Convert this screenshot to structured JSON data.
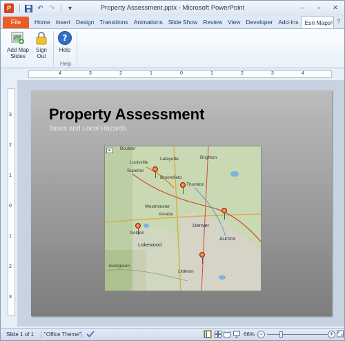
{
  "window": {
    "title": "Property Assessment.pptx - Microsoft PowerPoint",
    "app_icon": "P",
    "controls": [
      "–",
      "▫",
      "✕"
    ]
  },
  "qat": {
    "save_icon": "💾",
    "undo_icon": "↶",
    "redo_icon": "↷",
    "customize_icon": "▾"
  },
  "tabs": {
    "file_label": "File",
    "items": [
      "Home",
      "Insert",
      "Design",
      "Transitions",
      "Animations",
      "Slide Show",
      "Review",
      "View",
      "Developer",
      "Add-Ins",
      "Esri Maps"
    ],
    "active": "Esri Maps",
    "minimize_icon": "▵",
    "help_icon": "?"
  },
  "ribbon": {
    "add_map_label_1": "Add Map",
    "add_map_label_2": "Slides",
    "sign_out_label_1": "Sign",
    "sign_out_label_2": "Out",
    "help_label": "Help",
    "help_group_label": "Help"
  },
  "ruler": {
    "h_labels": [
      "4",
      "3",
      "2",
      "1",
      "0",
      "1",
      "2",
      "3",
      "4"
    ],
    "v_labels": [
      "3",
      "2",
      "1",
      "0",
      "1",
      "2",
      "3"
    ]
  },
  "slide": {
    "title": "Property Assessment",
    "subtitle": "Taxes and Local Hazards"
  },
  "map": {
    "expand_glyph": "▸",
    "labels": [
      "Boulder",
      "Lafayette",
      "Brighton",
      "Louisville",
      "Superior",
      "Broomfield",
      "Thornton",
      "Westminster",
      "Arvada",
      "Golden",
      "Denver",
      "Aurora",
      "Lakewood",
      "Evergreen",
      "Littleton"
    ]
  },
  "status": {
    "slide_info": "Slide 1 of 1",
    "theme": "\"Office Theme\"",
    "zoom": "66%",
    "zoom_level_percent": 66
  },
  "colors": {
    "file_tab": "#e85d2a",
    "pin": "#d94a10",
    "map_bg": "#cfdcb8"
  }
}
